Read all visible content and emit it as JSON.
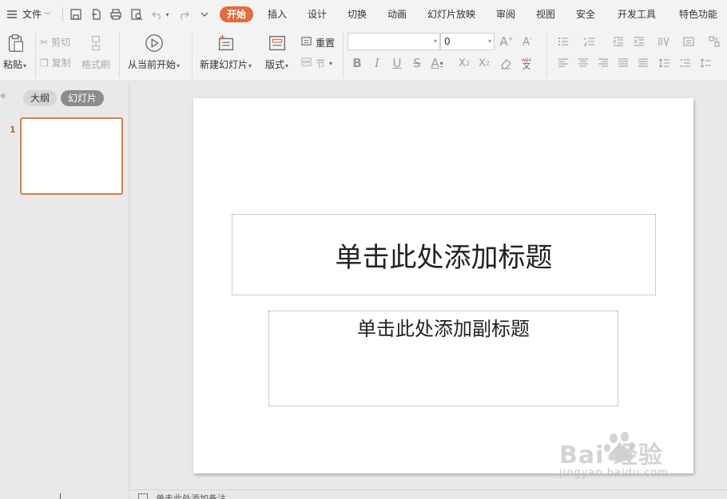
{
  "menubar": {
    "file_label": "文件",
    "tabs": [
      "开始",
      "插入",
      "设计",
      "切换",
      "动画",
      "幻灯片放映",
      "审阅",
      "视图",
      "安全",
      "开发工具",
      "特色功能"
    ],
    "active_tab": "开始"
  },
  "ribbon": {
    "paste": "粘贴",
    "cut": "剪切",
    "copy": "复制",
    "format_painter": "格式刷",
    "from_current": "从当前开始",
    "new_slide": "新建幻灯片",
    "layout": "版式",
    "reset": "重置",
    "section": "节",
    "font_name": "",
    "font_size": "0"
  },
  "leftpanel": {
    "outline_tab": "大纲",
    "slides_tab": "幻灯片",
    "slide_number": "1"
  },
  "slide": {
    "title_placeholder": "单击此处添加标题",
    "subtitle_placeholder": "单击此处添加副标题"
  },
  "notes": {
    "placeholder": "单击此处添加备注"
  },
  "watermark": {
    "logo": "Bai  经验",
    "url": "jingyan.baidu.com"
  },
  "colors": {
    "accent": "#e46b3a",
    "thumbnail_border": "#e07b45"
  }
}
